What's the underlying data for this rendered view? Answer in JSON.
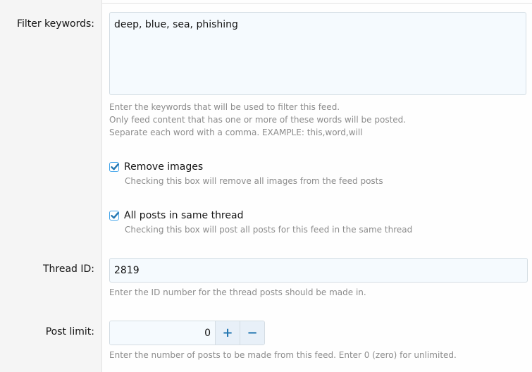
{
  "filter_keywords": {
    "label": "Filter keywords:",
    "value": "deep, blue, sea, phishing",
    "explain_lines": [
      "Enter the keywords that will be used to filter this feed.",
      "Only feed content that has one or more of these words will be posted.",
      "Separate each word with a comma. EXAMPLE: this,word,will"
    ]
  },
  "remove_images": {
    "label": "Remove images",
    "checked": true,
    "hint": "Checking this box will remove all images from the feed posts"
  },
  "same_thread": {
    "label": "All posts in same thread",
    "checked": true,
    "hint": "Checking this box will post all posts for this feed in the same thread"
  },
  "thread_id": {
    "label": "Thread ID:",
    "value": "2819",
    "explain": "Enter the ID number for the thread posts should be made in."
  },
  "post_limit": {
    "label": "Post limit:",
    "value": "0",
    "increment_label": "+",
    "decrement_label": "−",
    "explain": "Enter the number of posts to be made from this feed. Enter 0 (zero) for unlimited."
  },
  "colors": {
    "accent": "#2577b1",
    "checkbox_border": "#47a7eb",
    "hint_text": "#8c8c8c",
    "input_bg": "#f5fafe",
    "label_column_bg": "#f5f5f5"
  },
  "icons": {
    "checkbox": "checkmark-icon",
    "increment": "plus-icon",
    "decrement": "minus-icon"
  }
}
